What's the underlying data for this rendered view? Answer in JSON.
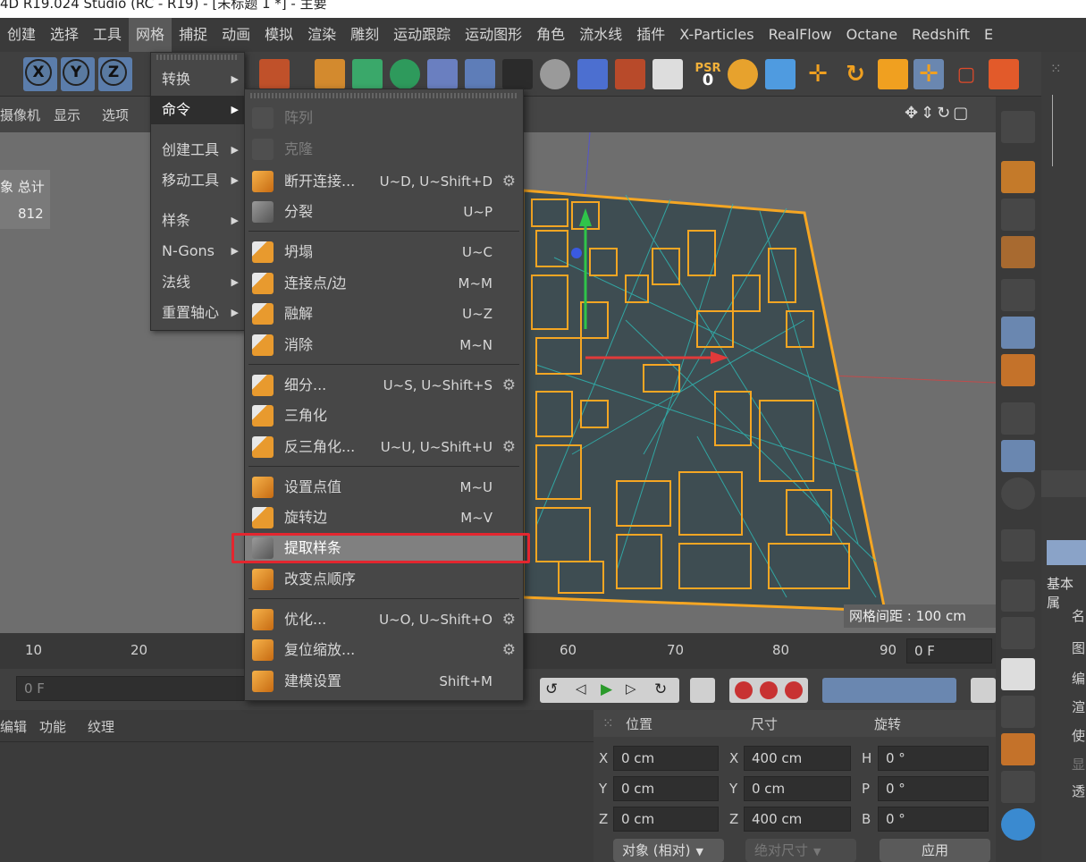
{
  "window": {
    "title": "4D R19.024 Studio (RC - R19) - [未标题 1 *] - 主要"
  },
  "menubar": {
    "items": [
      "创建",
      "选择",
      "工具",
      "网格",
      "捕捉",
      "动画",
      "模拟",
      "渲染",
      "雕刻",
      "运动跟踪",
      "运动图形",
      "角色",
      "流水线",
      "插件",
      "X-Particles",
      "RealFlow",
      "Octane",
      "Redshift",
      "E"
    ],
    "active": "网格"
  },
  "toolbar": {
    "axis_buttons": [
      "X",
      "Y",
      "Z"
    ],
    "psr_label": "PSR",
    "psr_value": "0"
  },
  "viewport": {
    "menu": [
      "摄像机",
      "显示",
      "选项"
    ],
    "stats_label": "象 总计",
    "stats_value": "812",
    "grid_spacing": "网格间距 : 100 cm"
  },
  "mesh_submenu": {
    "items": [
      {
        "label": "转换",
        "arrow": "▶"
      },
      {
        "label": "命令",
        "arrow": "▶"
      },
      {
        "label": "创建工具",
        "arrow": "▶"
      },
      {
        "label": "移动工具",
        "arrow": "▶"
      },
      {
        "label": "样条",
        "arrow": "▶"
      },
      {
        "label": "N-Gons",
        "arrow": "▶"
      },
      {
        "label": "法线",
        "arrow": "▶"
      },
      {
        "label": "重置轴心",
        "arrow": "▶"
      }
    ]
  },
  "command_menu": {
    "items": [
      {
        "label": "阵列",
        "shortcut": "",
        "gear": ""
      },
      {
        "label": "克隆",
        "shortcut": "",
        "gear": ""
      },
      {
        "label": "断开连接...",
        "shortcut": "U~D, U~Shift+D",
        "gear": "⚙"
      },
      {
        "label": "分裂",
        "shortcut": "U~P",
        "gear": ""
      },
      {
        "label": "坍塌",
        "shortcut": "U~C",
        "gear": ""
      },
      {
        "label": "连接点/边",
        "shortcut": "M~M",
        "gear": ""
      },
      {
        "label": "融解",
        "shortcut": "U~Z",
        "gear": ""
      },
      {
        "label": "消除",
        "shortcut": "M~N",
        "gear": ""
      },
      {
        "label": "细分...",
        "shortcut": "U~S, U~Shift+S",
        "gear": "⚙"
      },
      {
        "label": "三角化",
        "shortcut": "",
        "gear": ""
      },
      {
        "label": "反三角化...",
        "shortcut": "U~U, U~Shift+U",
        "gear": "⚙"
      },
      {
        "label": "设置点值",
        "shortcut": "M~U",
        "gear": ""
      },
      {
        "label": "旋转边",
        "shortcut": "M~V",
        "gear": ""
      },
      {
        "label": "提取样条",
        "shortcut": "",
        "gear": ""
      },
      {
        "label": "改变点顺序",
        "shortcut": "",
        "gear": ""
      },
      {
        "label": "优化...",
        "shortcut": "U~O, U~Shift+O",
        "gear": "⚙"
      },
      {
        "label": "复位缩放...",
        "shortcut": "",
        "gear": "⚙"
      },
      {
        "label": "建模设置",
        "shortcut": "Shift+M",
        "gear": ""
      }
    ]
  },
  "timeline": {
    "ticks": [
      "10",
      "20",
      "60",
      "70",
      "80",
      "90"
    ],
    "frame_end": "0 F",
    "frame_start": "0 F"
  },
  "bottom_tabs": [
    "编辑",
    "功能",
    "纹理"
  ],
  "coordinates": {
    "headers": [
      "位置",
      "尺寸",
      "旋转"
    ],
    "rows": [
      {
        "pos_axis": "X",
        "pos": "0 cm",
        "size_axis": "X",
        "size": "400 cm",
        "rot_axis": "H",
        "rot": "0 °"
      },
      {
        "pos_axis": "Y",
        "pos": "0 cm",
        "size_axis": "Y",
        "size": "0 cm",
        "rot_axis": "P",
        "rot": "0 °"
      },
      {
        "pos_axis": "Z",
        "pos": "0 cm",
        "size_axis": "Z",
        "size": "400 cm",
        "rot_axis": "B",
        "rot": "0 °"
      }
    ],
    "mode": "对象 (相对)",
    "size_mode": "绝对尺寸",
    "apply": "应用"
  },
  "right_panel": {
    "attr_title": "基本属",
    "labels": [
      "名",
      "图",
      "编",
      "渲",
      "使",
      "显",
      "透"
    ]
  }
}
